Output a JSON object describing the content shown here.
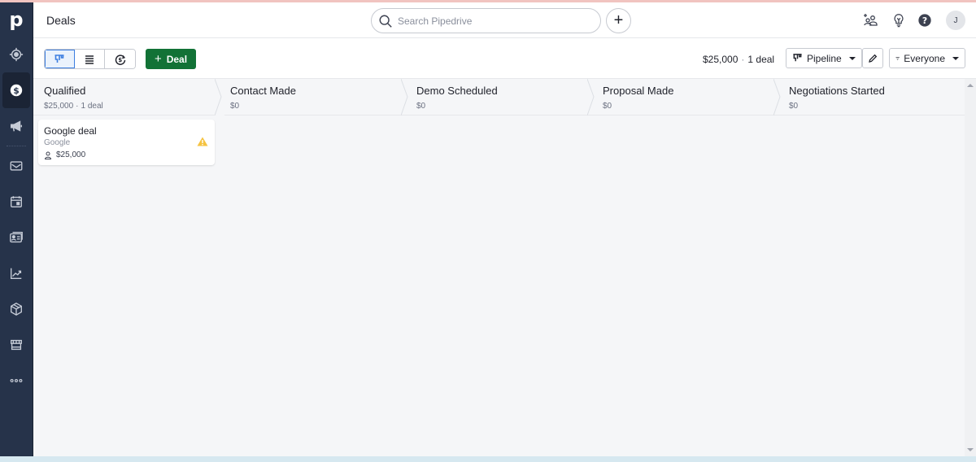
{
  "app": {
    "logo": "p",
    "page_title": "Deals"
  },
  "header": {
    "search_placeholder": "Search Pipedrive",
    "add_label": "+",
    "icons": [
      "invite-user-icon",
      "lightbulb-icon",
      "help-icon"
    ],
    "avatar_initial": "J"
  },
  "sidebar": {
    "items": [
      {
        "name": "focus",
        "icon": "target-icon",
        "active": false
      },
      {
        "name": "deals",
        "icon": "dollar-icon",
        "active": true
      },
      {
        "name": "campaigns",
        "icon": "megaphone-icon",
        "active": false
      },
      {
        "name": "mail",
        "icon": "mail-icon",
        "active": false
      },
      {
        "name": "activities",
        "icon": "calendar-icon",
        "active": false
      },
      {
        "name": "contacts",
        "icon": "contact-card-icon",
        "active": false
      },
      {
        "name": "insights",
        "icon": "chart-icon",
        "active": false
      },
      {
        "name": "products",
        "icon": "box-icon",
        "active": false
      },
      {
        "name": "marketplace",
        "icon": "store-icon",
        "active": false
      },
      {
        "name": "more",
        "icon": "more-icon",
        "active": false
      }
    ]
  },
  "toolbar": {
    "views": [
      "pipeline-view",
      "list-view",
      "forecast-view"
    ],
    "active_view": "pipeline-view",
    "add_deal_label": "Deal",
    "summary_value": "$25,000",
    "summary_sep": "·",
    "summary_count": "1 deal",
    "pipeline_label": "Pipeline",
    "filter_label": "Everyone"
  },
  "stages": [
    {
      "name": "Qualified",
      "value": "$25,000",
      "count": "1 deal"
    },
    {
      "name": "Contact Made",
      "value": "$0",
      "count": ""
    },
    {
      "name": "Demo Scheduled",
      "value": "$0",
      "count": ""
    },
    {
      "name": "Proposal Made",
      "value": "$0",
      "count": ""
    },
    {
      "name": "Negotiations Started",
      "value": "$0",
      "count": ""
    }
  ],
  "deals": [
    {
      "stage": "Qualified",
      "title": "Google deal",
      "organization": "Google",
      "value": "$25,000",
      "warning": true
    }
  ],
  "colors": {
    "accent_green": "#127236",
    "sidebar_bg": "#26334a",
    "warning": "#f5c342",
    "active_view": "#3c7ee0"
  }
}
